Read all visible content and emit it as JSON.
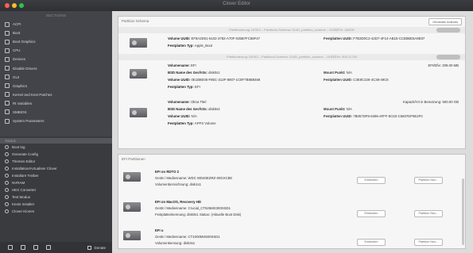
{
  "window": {
    "title": "Clover Editor"
  },
  "sidebar": {
    "heading": "SECTIONS",
    "items": [
      {
        "label": "ACPI",
        "icon": "acpi-icon"
      },
      {
        "label": "Boot",
        "icon": "boot-icon"
      },
      {
        "label": "Boot Graphics",
        "icon": "boot-graphics-icon"
      },
      {
        "label": "CPU",
        "icon": "cpu-icon"
      },
      {
        "label": "Devices",
        "icon": "devices-icon"
      },
      {
        "label": "Disable Drivers",
        "icon": "disable-drivers-icon"
      },
      {
        "label": "GUI",
        "icon": "gui-icon"
      },
      {
        "label": "Graphics",
        "icon": "graphics-icon"
      },
      {
        "label": "Kernel and Kext Patches",
        "icon": "kernel-icon"
      },
      {
        "label": "Rt Variables",
        "icon": "rt-variables-icon"
      },
      {
        "label": "SMBIOS",
        "icon": "smbios-icon"
      },
      {
        "label": "System Parameters",
        "icon": "system-parameters-icon"
      }
    ],
    "tools_heading": "TOOLS",
    "tools": [
      {
        "label": "Boot log",
        "icon": "boot-log-icon"
      },
      {
        "label": "Generate Config",
        "icon": "generate-config-icon"
      },
      {
        "label": "Themes Editor",
        "icon": "themes-editor-icon"
      },
      {
        "label": "Installation/Actualiser Clover",
        "icon": "installer-icon"
      },
      {
        "label": "Installare Treiber",
        "icon": "drivers-icon"
      },
      {
        "label": "NVRAM",
        "icon": "nvram-icon"
      },
      {
        "label": "HEX Converter",
        "icon": "hex-converter-icon"
      },
      {
        "label": "Text Modus",
        "icon": "text-mode-icon"
      },
      {
        "label": "Kexts Installer",
        "icon": "kexts-installer-icon"
      },
      {
        "label": "Clover Klonen",
        "icon": "clover-clone-icon"
      }
    ],
    "footer": {
      "donate_label": "Donate"
    }
  },
  "partitions": {
    "title": "Partition Schema",
    "button": "Generate Indexes",
    "groups": [
      {
        "head": "Partitionierung: DISK0 – Partitions-Schema: GUID_partition_scheme – GrÃ¶ÃŸe: 480GB",
        "rows": [
          {
            "label": "Volume UUID:",
            "value": "EF8A2D01-6102-3782-A70F-035B7FC58F47",
            "right_label": "Festplatten UUID:",
            "right_value": "F7B3D0C2-42D7-4F14-AB15-CCB0BE5A9E87"
          },
          {
            "label": "Festplatten Typ:",
            "value": "Apple_Boot"
          }
        ]
      },
      {
        "head": "Partitionierung: DISK0 – Partitions-Schema: GUID_partition_scheme – GrÃ¶ÃŸe: 500.11 GB",
        "rows": [
          {
            "label": "Volumename:",
            "value": "EFI",
            "right_label": "",
            "right_value": "",
            "extra": "EFI/Efie:  209.00 MB"
          },
          {
            "label": "BSD Name des GerÃ¤ts:",
            "value": "disk0s1",
            "right_label": "Mount Punkt:",
            "right_value": "N/A"
          },
          {
            "label": "Volume UUID:",
            "value": "0E1B8E05-F85C-313F-8807-1C8F7B8B8468",
            "right_label": "Festplatten UUID:",
            "right_value": "C3E8C226-4C38-49C6"
          },
          {
            "label": "Festplatten Typ:",
            "value": "EFI"
          }
        ]
      },
      {
        "head": "",
        "rows": [
          {
            "label": "Volumename:",
            "value": "Okna Titel",
            "right_label": "",
            "right_value": "",
            "extra": "KapazitÃ¤t in Benutzung:  500.00 GB"
          },
          {
            "label": "BSD Name des GerÃ¤ts:",
            "value": "disk0s2",
            "right_label": "Mount Punkt:",
            "right_value": "N/A"
          },
          {
            "label": "Volume UUID:",
            "value": "N/A",
            "right_label": "Festplatten UUID:",
            "right_value": "7B057DF8-6396-4FFF-8C02-C5607DF9E2F0"
          },
          {
            "label": "Festplatten Typ:",
            "value": "APFS Volume"
          }
        ]
      }
    ]
  },
  "efi": {
    "title": "EFI Partitionen",
    "disks": [
      {
        "name": "EFI on RDTO 2",
        "model": "Gerät / Medienname: WDC WD40EZRZ-00GXCB0",
        "volume": "Volumenbezeichnung: disk1s1",
        "btn1": "Einbinden",
        "btn2": "Partition Neu..."
      },
      {
        "name": "EFI on MacOS, Recovery HD",
        "model": "Gerät / Medienname: Crucial_CT525MX300SSD1",
        "volume": "Festplattenkennung: disk0s1 Status: (Aktuelle Boot Disk)",
        "btn1": "Einbinden",
        "btn2": "Partition Neu..."
      },
      {
        "name": "EFI u",
        "model": "Gerät / Medienname: CT1000MX500SSD1",
        "volume": "Volumenkennung: disk3s1",
        "btn1": "Einbinden",
        "btn2": "Partition Neu..."
      }
    ]
  }
}
